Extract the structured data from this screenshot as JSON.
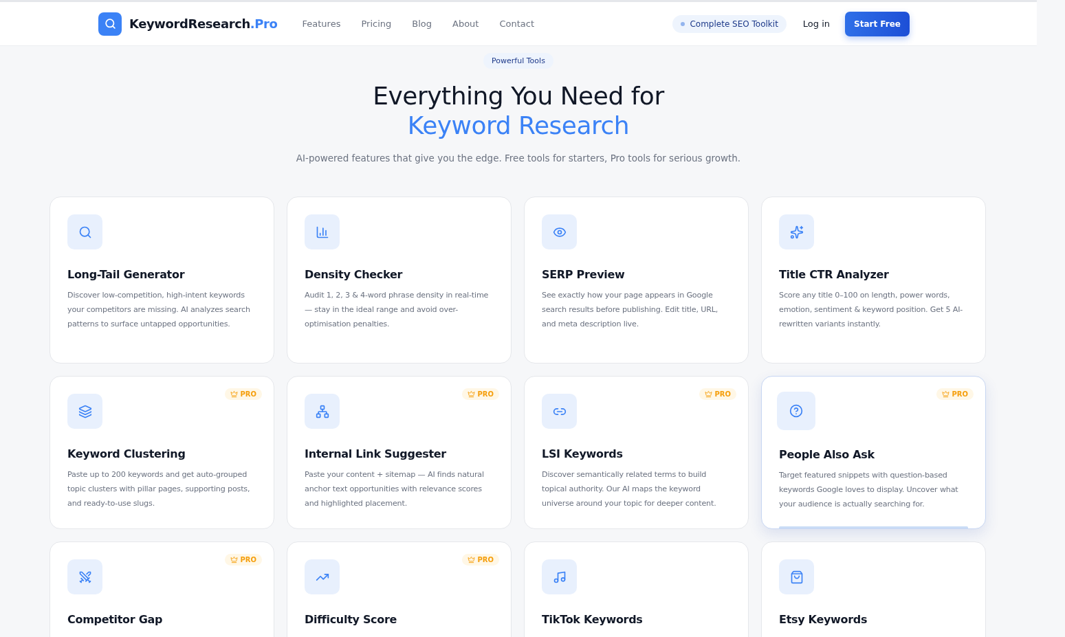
{
  "nav": {
    "logo": {
      "name": "KeywordResearch",
      "suffix": ".Pro"
    },
    "links": [
      "Features",
      "Pricing",
      "Blog",
      "About",
      "Contact"
    ],
    "badge": "Complete SEO Toolkit",
    "login": "Log in",
    "cta": "Start Free"
  },
  "hero": {
    "eyebrow": "Powerful Tools",
    "title": "Everything You Need for",
    "title_accent": "Keyword Research",
    "subtitle": "AI-powered features that give you the edge. Free tools for starters, Pro tools for serious growth."
  },
  "features": [
    {
      "title": "Long-Tail Generator",
      "description": "Discover low-competition, high-intent keywords your competitors are missing. AI analyzes search patterns to surface untapped opportunities.",
      "pro": false,
      "highlighted": false
    },
    {
      "title": "Density Checker",
      "description": "Audit 1, 2, 3 & 4-word phrase density in real-time — stay in the ideal range and avoid over-optimisation penalties.",
      "pro": false,
      "highlighted": false
    },
    {
      "title": "SERP Preview",
      "description": "See exactly how your page appears in Google search results before publishing. Edit title, URL, and meta description live.",
      "pro": false,
      "highlighted": false
    },
    {
      "title": "Title CTR Analyzer",
      "description": "Score any title 0–100 on length, power words, emotion, sentiment & keyword position. Get 5 AI-rewritten variants instantly.",
      "pro": false,
      "highlighted": false
    },
    {
      "title": "Keyword Clustering",
      "description": "Paste up to 200 keywords and get auto-grouped topic clusters with pillar pages, supporting posts, and ready-to-use slugs.",
      "pro": true,
      "pro_label": "PRO",
      "highlighted": false
    },
    {
      "title": "Internal Link Suggester",
      "description": "Paste your content + sitemap — AI finds natural anchor text opportunities with relevance scores and highlighted placement.",
      "pro": true,
      "pro_label": "PRO",
      "highlighted": false
    },
    {
      "title": "LSI Keywords",
      "description": "Discover semantically related terms to build topical authority. Our AI maps the keyword universe around your topic for deeper content.",
      "pro": true,
      "pro_label": "PRO",
      "highlighted": false
    },
    {
      "title": "People Also Ask",
      "description": "Target featured snippets with question-based keywords Google loves to display. Uncover what your audience is actually searching for.",
      "pro": true,
      "pro_label": "PRO",
      "highlighted": true
    },
    {
      "title": "Competitor Gap",
      "pro": true,
      "pro_label": "PRO",
      "highlighted": false
    },
    {
      "title": "Difficulty Score",
      "pro": true,
      "pro_label": "PRO",
      "highlighted": false
    },
    {
      "title": "TikTok Keywords",
      "pro": false,
      "highlighted": false
    },
    {
      "title": "Etsy Keywords",
      "pro": false,
      "highlighted": false
    }
  ]
}
